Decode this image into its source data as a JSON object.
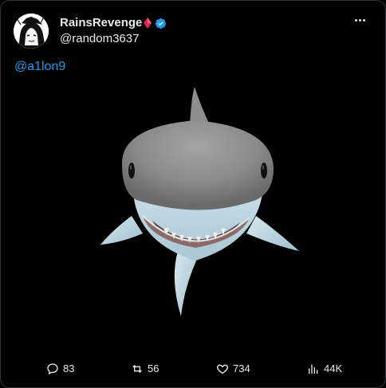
{
  "user": {
    "display_name": "RainsRevenge",
    "handle": "@random3637",
    "verified": true,
    "name_emoji": "red-diamond",
    "verified_color": "#1d9bf0"
  },
  "tweet": {
    "mention": "@a1lon9"
  },
  "media": {
    "subject_icon": "shark-image"
  },
  "actions": {
    "replies": "83",
    "retweets": "56",
    "likes": "734",
    "views": "44K"
  },
  "colors": {
    "background": "#000000",
    "text": "#e7e9ea",
    "accent": "#1d9bf0"
  }
}
